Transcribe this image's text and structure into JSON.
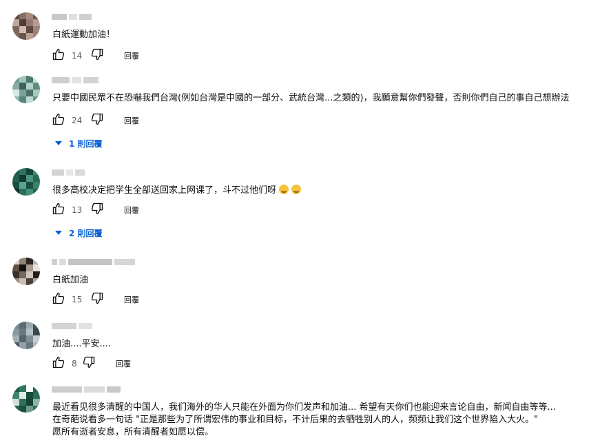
{
  "reply_label": "回覆",
  "comments": [
    {
      "text": "白紙運動加油！",
      "likes": "14"
    },
    {
      "text": "只要中國民眾不在恐嚇我們台灣(例如台灣是中國的一部分、武統台灣...之類的)，我願意幫你們發聲，否則你們自己的事自己想辦法",
      "likes": "24",
      "replies": "1 則回覆"
    },
    {
      "text": "很多高校决定把学生全部送回家上网课了，斗不过他们呀",
      "emoji": "grinning-sweat-emoji",
      "likes": "13",
      "replies": "2 則回覆"
    },
    {
      "text": "白紙加油",
      "likes": "15"
    },
    {
      "text": "加油....平安....",
      "likes": "8"
    },
    {
      "lines": [
        "最近看见很多清醒的中国人，我们海外的华人只能在外面为你们发声和加油... 希望有天你们也能迎来言论自由，新闻自由等等...",
        "在奇葩说看多一句话 \"正是那些为了所谓宏伟的事业和目标，不计后果的去牺牲别人的人，频频让我们这个世界陷入大火。\"",
        "愿所有逝者安息，所有清醒者如愿以偿。"
      ]
    }
  ],
  "colors": {
    "text": "#0f0f0f",
    "secondary": "#606060",
    "link": "#065fd4"
  }
}
